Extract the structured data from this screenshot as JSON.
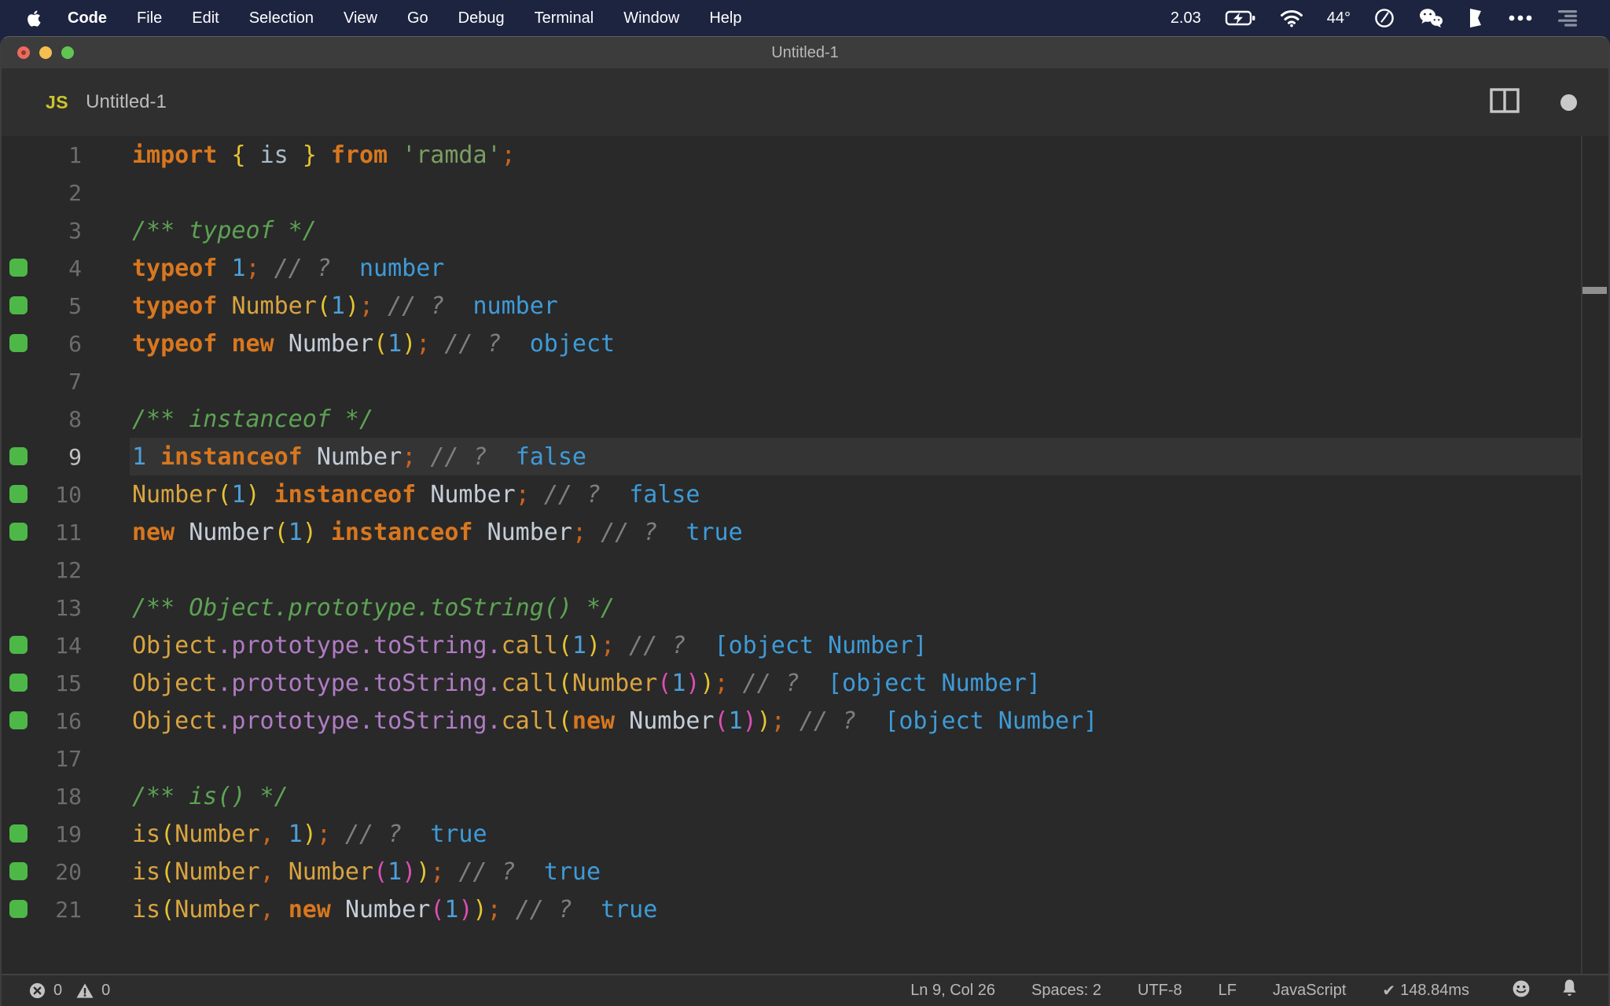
{
  "colors": {
    "menubar_bg": "#1d2440",
    "editor_bg": "#292929",
    "titlebar_bg": "#3c3c3c",
    "tabbar_bg": "#2f2f2f",
    "statusbar_bg": "#2d2d2d",
    "line_highlight": "#343434",
    "quokka_marker_green": "#4db848",
    "traffic_red": "#ec6a5e",
    "traffic_yellow": "#f5bf4f",
    "traffic_green": "#61c554",
    "js_badge_yellow": "#cdc42c",
    "tokens": {
      "kw": "#d8771f",
      "fn": "#d9a440",
      "num": "#4d9fd8",
      "out": "#3e9bd8",
      "str": "#7a9e63",
      "cmt": "#5da254",
      "cm2": "#7e7e7e",
      "prop": "#b07cc4",
      "cls": "#c4cdd8",
      "var": "#a9bcca",
      "pun": "#c9641f",
      "br1": "#e5c431",
      "br2": "#dd4fb4",
      "pl": "#cfcfcf"
    }
  },
  "menubar": {
    "items": [
      "Code",
      "File",
      "Edit",
      "Selection",
      "View",
      "Go",
      "Debug",
      "Terminal",
      "Window",
      "Help"
    ],
    "right": {
      "cpu": "2.03",
      "temp": "44°"
    },
    "right_icons": [
      "battery-charging-icon",
      "wifi-icon",
      "clock-icon",
      "wechat-icon",
      "flag-icon",
      "ellipsis-icon",
      "list-icon"
    ]
  },
  "window": {
    "title": "Untitled-1"
  },
  "tab": {
    "badge": "JS",
    "filename": "Untitled-1"
  },
  "editor": {
    "lines": [
      {
        "n": 1,
        "mark": false,
        "active": false,
        "tokens": [
          [
            "kw",
            "import"
          ],
          [
            "pl",
            " "
          ],
          [
            "br1",
            "{"
          ],
          [
            "pl",
            " "
          ],
          [
            "var",
            "is"
          ],
          [
            "pl",
            " "
          ],
          [
            "br1",
            "}"
          ],
          [
            "pl",
            " "
          ],
          [
            "kw",
            "from"
          ],
          [
            "pl",
            " "
          ],
          [
            "str",
            "'ramda'"
          ],
          [
            "pun",
            ";"
          ]
        ]
      },
      {
        "n": 2,
        "mark": false,
        "active": false,
        "tokens": []
      },
      {
        "n": 3,
        "mark": false,
        "active": false,
        "tokens": [
          [
            "cmt",
            "/** typeof */"
          ]
        ]
      },
      {
        "n": 4,
        "mark": true,
        "active": false,
        "tokens": [
          [
            "kw",
            "typeof"
          ],
          [
            "pl",
            " "
          ],
          [
            "num",
            "1"
          ],
          [
            "pun",
            ";"
          ],
          [
            "pl",
            " "
          ],
          [
            "cm2",
            "// ?"
          ],
          [
            "pl",
            "  "
          ],
          [
            "out",
            "number"
          ]
        ]
      },
      {
        "n": 5,
        "mark": true,
        "active": false,
        "tokens": [
          [
            "kw",
            "typeof"
          ],
          [
            "pl",
            " "
          ],
          [
            "fn",
            "Number"
          ],
          [
            "br1",
            "("
          ],
          [
            "num",
            "1"
          ],
          [
            "br1",
            ")"
          ],
          [
            "pun",
            ";"
          ],
          [
            "pl",
            " "
          ],
          [
            "cm2",
            "// ?"
          ],
          [
            "pl",
            "  "
          ],
          [
            "out",
            "number"
          ]
        ]
      },
      {
        "n": 6,
        "mark": true,
        "active": false,
        "tokens": [
          [
            "kw",
            "typeof"
          ],
          [
            "pl",
            " "
          ],
          [
            "kw",
            "new"
          ],
          [
            "pl",
            " "
          ],
          [
            "cls",
            "Number"
          ],
          [
            "br1",
            "("
          ],
          [
            "num",
            "1"
          ],
          [
            "br1",
            ")"
          ],
          [
            "pun",
            ";"
          ],
          [
            "pl",
            " "
          ],
          [
            "cm2",
            "// ?"
          ],
          [
            "pl",
            "  "
          ],
          [
            "out",
            "object"
          ]
        ]
      },
      {
        "n": 7,
        "mark": false,
        "active": false,
        "tokens": []
      },
      {
        "n": 8,
        "mark": false,
        "active": false,
        "tokens": [
          [
            "cmt",
            "/** instanceof */"
          ]
        ]
      },
      {
        "n": 9,
        "mark": true,
        "active": true,
        "tokens": [
          [
            "num",
            "1"
          ],
          [
            "pl",
            " "
          ],
          [
            "kw",
            "instanceof"
          ],
          [
            "pl",
            " "
          ],
          [
            "cls",
            "Number"
          ],
          [
            "pun",
            ";"
          ],
          [
            "pl",
            " "
          ],
          [
            "cm2",
            "// ?"
          ],
          [
            "pl",
            "  "
          ],
          [
            "out",
            "false"
          ]
        ]
      },
      {
        "n": 10,
        "mark": true,
        "active": false,
        "tokens": [
          [
            "fn",
            "Number"
          ],
          [
            "br1",
            "("
          ],
          [
            "num",
            "1"
          ],
          [
            "br1",
            ")"
          ],
          [
            "pl",
            " "
          ],
          [
            "kw",
            "instanceof"
          ],
          [
            "pl",
            " "
          ],
          [
            "cls",
            "Number"
          ],
          [
            "pun",
            ";"
          ],
          [
            "pl",
            " "
          ],
          [
            "cm2",
            "// ?"
          ],
          [
            "pl",
            "  "
          ],
          [
            "out",
            "false"
          ]
        ]
      },
      {
        "n": 11,
        "mark": true,
        "active": false,
        "tokens": [
          [
            "kw",
            "new"
          ],
          [
            "pl",
            " "
          ],
          [
            "cls",
            "Number"
          ],
          [
            "br1",
            "("
          ],
          [
            "num",
            "1"
          ],
          [
            "br1",
            ")"
          ],
          [
            "pl",
            " "
          ],
          [
            "kw",
            "instanceof"
          ],
          [
            "pl",
            " "
          ],
          [
            "cls",
            "Number"
          ],
          [
            "pun",
            ";"
          ],
          [
            "pl",
            " "
          ],
          [
            "cm2",
            "// ?"
          ],
          [
            "pl",
            "  "
          ],
          [
            "out",
            "true"
          ]
        ]
      },
      {
        "n": 12,
        "mark": false,
        "active": false,
        "tokens": []
      },
      {
        "n": 13,
        "mark": false,
        "active": false,
        "tokens": [
          [
            "cmt",
            "/** Object.prototype.toString() */"
          ]
        ]
      },
      {
        "n": 14,
        "mark": true,
        "active": false,
        "tokens": [
          [
            "fn",
            "Object"
          ],
          [
            "prop",
            ".prototype.toString."
          ],
          [
            "fn",
            "call"
          ],
          [
            "br1",
            "("
          ],
          [
            "num",
            "1"
          ],
          [
            "br1",
            ")"
          ],
          [
            "pun",
            ";"
          ],
          [
            "pl",
            " "
          ],
          [
            "cm2",
            "// ?"
          ],
          [
            "pl",
            "  "
          ],
          [
            "out",
            "[object Number]"
          ]
        ]
      },
      {
        "n": 15,
        "mark": true,
        "active": false,
        "tokens": [
          [
            "fn",
            "Object"
          ],
          [
            "prop",
            ".prototype.toString."
          ],
          [
            "fn",
            "call"
          ],
          [
            "br1",
            "("
          ],
          [
            "fn",
            "Number"
          ],
          [
            "br2",
            "("
          ],
          [
            "num",
            "1"
          ],
          [
            "br2",
            ")"
          ],
          [
            "br1",
            ")"
          ],
          [
            "pun",
            ";"
          ],
          [
            "pl",
            " "
          ],
          [
            "cm2",
            "// ?"
          ],
          [
            "pl",
            "  "
          ],
          [
            "out",
            "[object Number]"
          ]
        ]
      },
      {
        "n": 16,
        "mark": true,
        "active": false,
        "tokens": [
          [
            "fn",
            "Object"
          ],
          [
            "prop",
            ".prototype.toString."
          ],
          [
            "fn",
            "call"
          ],
          [
            "br1",
            "("
          ],
          [
            "kw",
            "new"
          ],
          [
            "pl",
            " "
          ],
          [
            "cls",
            "Number"
          ],
          [
            "br2",
            "("
          ],
          [
            "num",
            "1"
          ],
          [
            "br2",
            ")"
          ],
          [
            "br1",
            ")"
          ],
          [
            "pun",
            ";"
          ],
          [
            "pl",
            " "
          ],
          [
            "cm2",
            "// ?"
          ],
          [
            "pl",
            "  "
          ],
          [
            "out",
            "[object Number]"
          ]
        ]
      },
      {
        "n": 17,
        "mark": false,
        "active": false,
        "tokens": []
      },
      {
        "n": 18,
        "mark": false,
        "active": false,
        "tokens": [
          [
            "cmt",
            "/** is() */"
          ]
        ]
      },
      {
        "n": 19,
        "mark": true,
        "active": false,
        "tokens": [
          [
            "fn",
            "is"
          ],
          [
            "br1",
            "("
          ],
          [
            "fn",
            "Number"
          ],
          [
            "pun",
            ","
          ],
          [
            "pl",
            " "
          ],
          [
            "num",
            "1"
          ],
          [
            "br1",
            ")"
          ],
          [
            "pun",
            ";"
          ],
          [
            "pl",
            " "
          ],
          [
            "cm2",
            "// ?"
          ],
          [
            "pl",
            "  "
          ],
          [
            "out",
            "true"
          ]
        ]
      },
      {
        "n": 20,
        "mark": true,
        "active": false,
        "tokens": [
          [
            "fn",
            "is"
          ],
          [
            "br1",
            "("
          ],
          [
            "fn",
            "Number"
          ],
          [
            "pun",
            ","
          ],
          [
            "pl",
            " "
          ],
          [
            "fn",
            "Number"
          ],
          [
            "br2",
            "("
          ],
          [
            "num",
            "1"
          ],
          [
            "br2",
            ")"
          ],
          [
            "br1",
            ")"
          ],
          [
            "pun",
            ";"
          ],
          [
            "pl",
            " "
          ],
          [
            "cm2",
            "// ?"
          ],
          [
            "pl",
            "  "
          ],
          [
            "out",
            "true"
          ]
        ]
      },
      {
        "n": 21,
        "mark": true,
        "active": false,
        "tokens": [
          [
            "fn",
            "is"
          ],
          [
            "br1",
            "("
          ],
          [
            "fn",
            "Number"
          ],
          [
            "pun",
            ","
          ],
          [
            "pl",
            " "
          ],
          [
            "kw",
            "new"
          ],
          [
            "pl",
            " "
          ],
          [
            "cls",
            "Number"
          ],
          [
            "br2",
            "("
          ],
          [
            "num",
            "1"
          ],
          [
            "br2",
            ")"
          ],
          [
            "br1",
            ")"
          ],
          [
            "pun",
            ";"
          ],
          [
            "pl",
            " "
          ],
          [
            "cm2",
            "// ?"
          ],
          [
            "pl",
            "  "
          ],
          [
            "out",
            "true"
          ]
        ]
      }
    ]
  },
  "statusbar": {
    "errors": "0",
    "warnings": "0",
    "cursor": "Ln 9, Col 26",
    "indent": "Spaces: 2",
    "encoding": "UTF-8",
    "eol": "LF",
    "language": "JavaScript",
    "check": "✔",
    "exec_time": "148.84ms"
  }
}
